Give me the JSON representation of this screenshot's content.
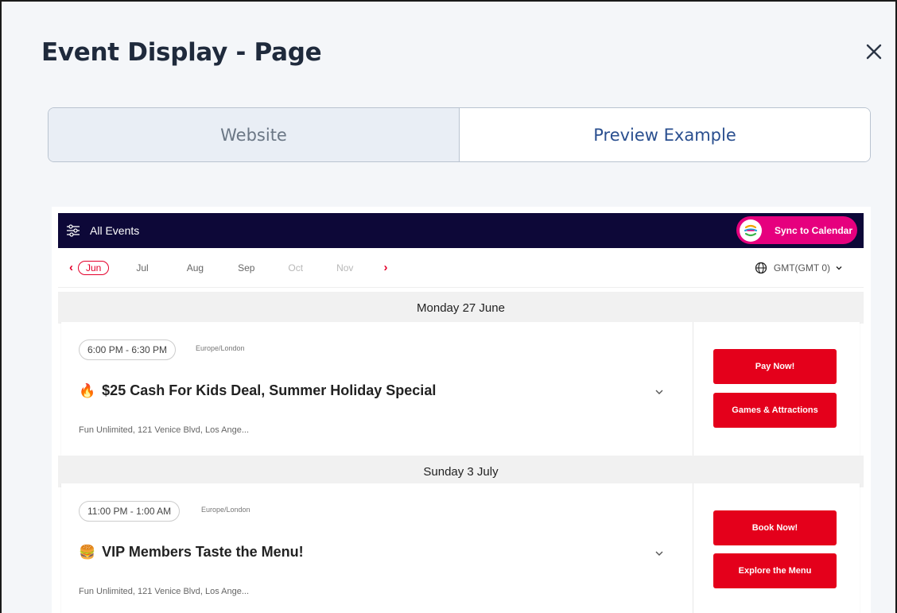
{
  "modal": {
    "title": "Event Display - Page",
    "close_icon": "close-icon"
  },
  "toggle": {
    "options": [
      {
        "label": "Website",
        "active": false
      },
      {
        "label": "Preview Example",
        "active": true
      }
    ]
  },
  "preview": {
    "topbar": {
      "filter_icon": "sliders-icon",
      "all_events_label": "All Events",
      "sync_label": "Sync to Calendar",
      "bg_color": "#0d0838",
      "sync_color": "#e6007e"
    },
    "months": {
      "prev_icon": "chevron-left-icon",
      "next_icon": "chevron-right-icon",
      "items": [
        {
          "label": "Jun",
          "state": "selected"
        },
        {
          "label": "Jul",
          "state": "normal"
        },
        {
          "label": "Aug",
          "state": "normal"
        },
        {
          "label": "Sep",
          "state": "normal"
        },
        {
          "label": "Oct",
          "state": "faded"
        },
        {
          "label": "Nov",
          "state": "faded"
        }
      ],
      "timezone_label": "GMT(GMT 0)",
      "accent_color": "#e4002b"
    },
    "days": [
      {
        "header": "Monday 27 June",
        "event": {
          "time": "6:00 PM - 6:30 PM",
          "timezone": "Europe/London",
          "emoji": "🔥",
          "title": "$25 Cash For Kids Deal, Summer Holiday Special",
          "location": "Fun Unlimited, 121 Venice Blvd, Los Ange...",
          "buttons": [
            "Pay Now!",
            "Games & Attractions"
          ]
        }
      },
      {
        "header": "Sunday 3 July",
        "event": {
          "time": "11:00 PM - 1:00 AM",
          "timezone": "Europe/London",
          "emoji": "🍔",
          "title": "VIP Members Taste the Menu!",
          "location": "Fun Unlimited, 121 Venice Blvd, Los Ange...",
          "buttons": [
            "Book Now!",
            "Explore the Menu"
          ]
        }
      }
    ],
    "button_color": "#e4001b"
  }
}
